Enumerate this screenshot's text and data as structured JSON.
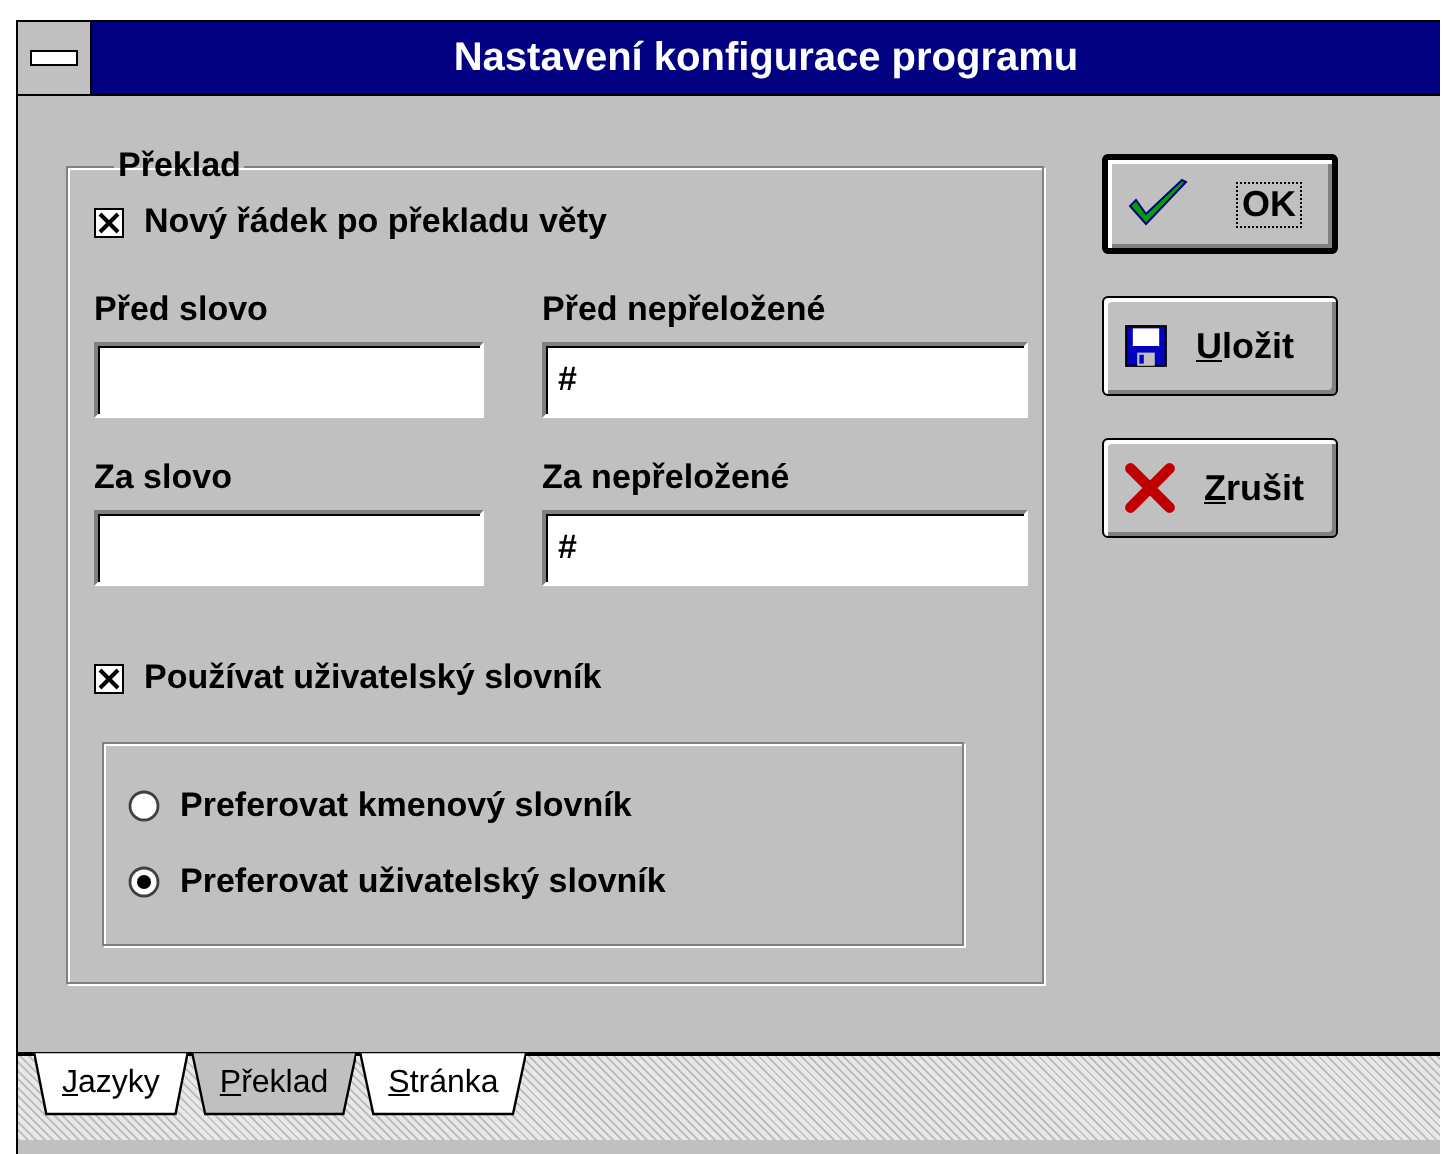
{
  "window": {
    "title": "Nastavení konfigurace programu"
  },
  "group": {
    "title": "Překlad"
  },
  "new_line_checkbox": {
    "label": "Nový řádek po překladu věty",
    "checked": true
  },
  "fields": [
    {
      "label": "Před slovo"
    },
    {
      "label": "Před nepřeložené",
      "value": "#"
    },
    {
      "label": "Za slovo"
    },
    {
      "label": "Za nepřeložené",
      "value": "#"
    }
  ],
  "user_dict_checkbox": {
    "label": "Používat uživatelský slovník",
    "checked": true
  },
  "radios": [
    {
      "label": "Preferovat kmenový slovník",
      "selected": false
    },
    {
      "label": "Preferovat uživatelský slovník",
      "selected": true
    }
  ],
  "buttons": [
    {
      "kind": "ok",
      "label": "OK",
      "focused": true,
      "underline_first": false
    },
    {
      "kind": "save",
      "label": "Uložit",
      "focused": false,
      "underline_first": true
    },
    {
      "kind": "cancel",
      "label": "Zrušit",
      "focused": false,
      "underline_first": true
    }
  ],
  "tabs": [
    {
      "label": "Jazyky",
      "selected": false,
      "underline_first": true
    },
    {
      "label": "Překlad",
      "selected": true,
      "underline_first": true
    },
    {
      "label": "Stránka",
      "selected": false,
      "underline_first": true
    }
  ]
}
